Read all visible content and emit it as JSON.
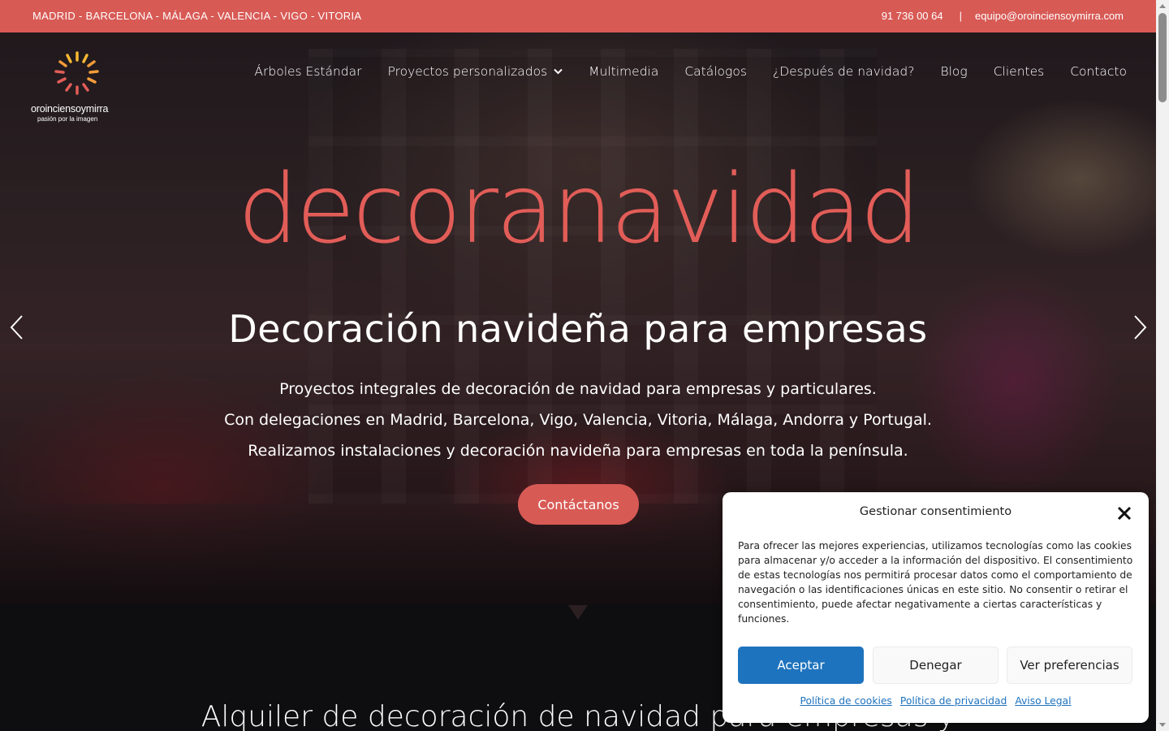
{
  "topbar": {
    "cities": "MADRID - BARCELONA - MÁLAGA - VALENCIA - VIGO - VITORIA",
    "phone": "91 736 00 64",
    "separator": "|",
    "email": "equipo@oroinciensoymirra.com"
  },
  "logo": {
    "name": "oroinciensoymirra",
    "tagline": "pasión por la imagen",
    "colors": [
      "#f7b733",
      "#e25d58",
      "#f39c3a"
    ]
  },
  "nav": {
    "items": [
      {
        "label": "Árboles Estándar"
      },
      {
        "label": "Proyectos personalizados",
        "has_dropdown": true
      },
      {
        "label": "Multimedia"
      },
      {
        "label": "Catálogos"
      },
      {
        "label": "¿Después de navidad?"
      },
      {
        "label": "Blog"
      },
      {
        "label": "Clientes"
      },
      {
        "label": "Contacto"
      }
    ]
  },
  "hero": {
    "brand": "decoranavidad",
    "title": "Decoración navideña para empresas",
    "lines": [
      "Proyectos integrales de decoración de navidad para empresas y particulares.",
      "Con delegaciones en Madrid, Barcelona, Vigo, Valencia, Vitoria, Málaga, Andorra y Portugal.",
      "Realizamos instalaciones y decoración navideña para empresas en toda la península."
    ],
    "cta": "Contáctanos",
    "prev_icon": "chevron-left-icon",
    "next_icon": "chevron-right-icon"
  },
  "section": {
    "title": "Alquiler de decoración de navidad para empresas y"
  },
  "consent": {
    "title": "Gestionar consentimiento",
    "body": "Para ofrecer las mejores experiencias, utilizamos tecnologías como las cookies para almacenar y/o acceder a la información del dispositivo. El consentimiento de estas tecnologías nos permitirá procesar datos como el comportamiento de navegación o las identificaciones únicas en este sitio. No consentir o retirar el consentimiento, puede afectar negativamente a ciertas características y funciones.",
    "accept": "Aceptar",
    "deny": "Denegar",
    "preferences": "Ver preferencias",
    "links": [
      "Política de cookies",
      "Política de privacidad",
      "Aviso Legal"
    ]
  },
  "colors": {
    "brand": "#d85a55",
    "accept_button": "#1e73be"
  }
}
